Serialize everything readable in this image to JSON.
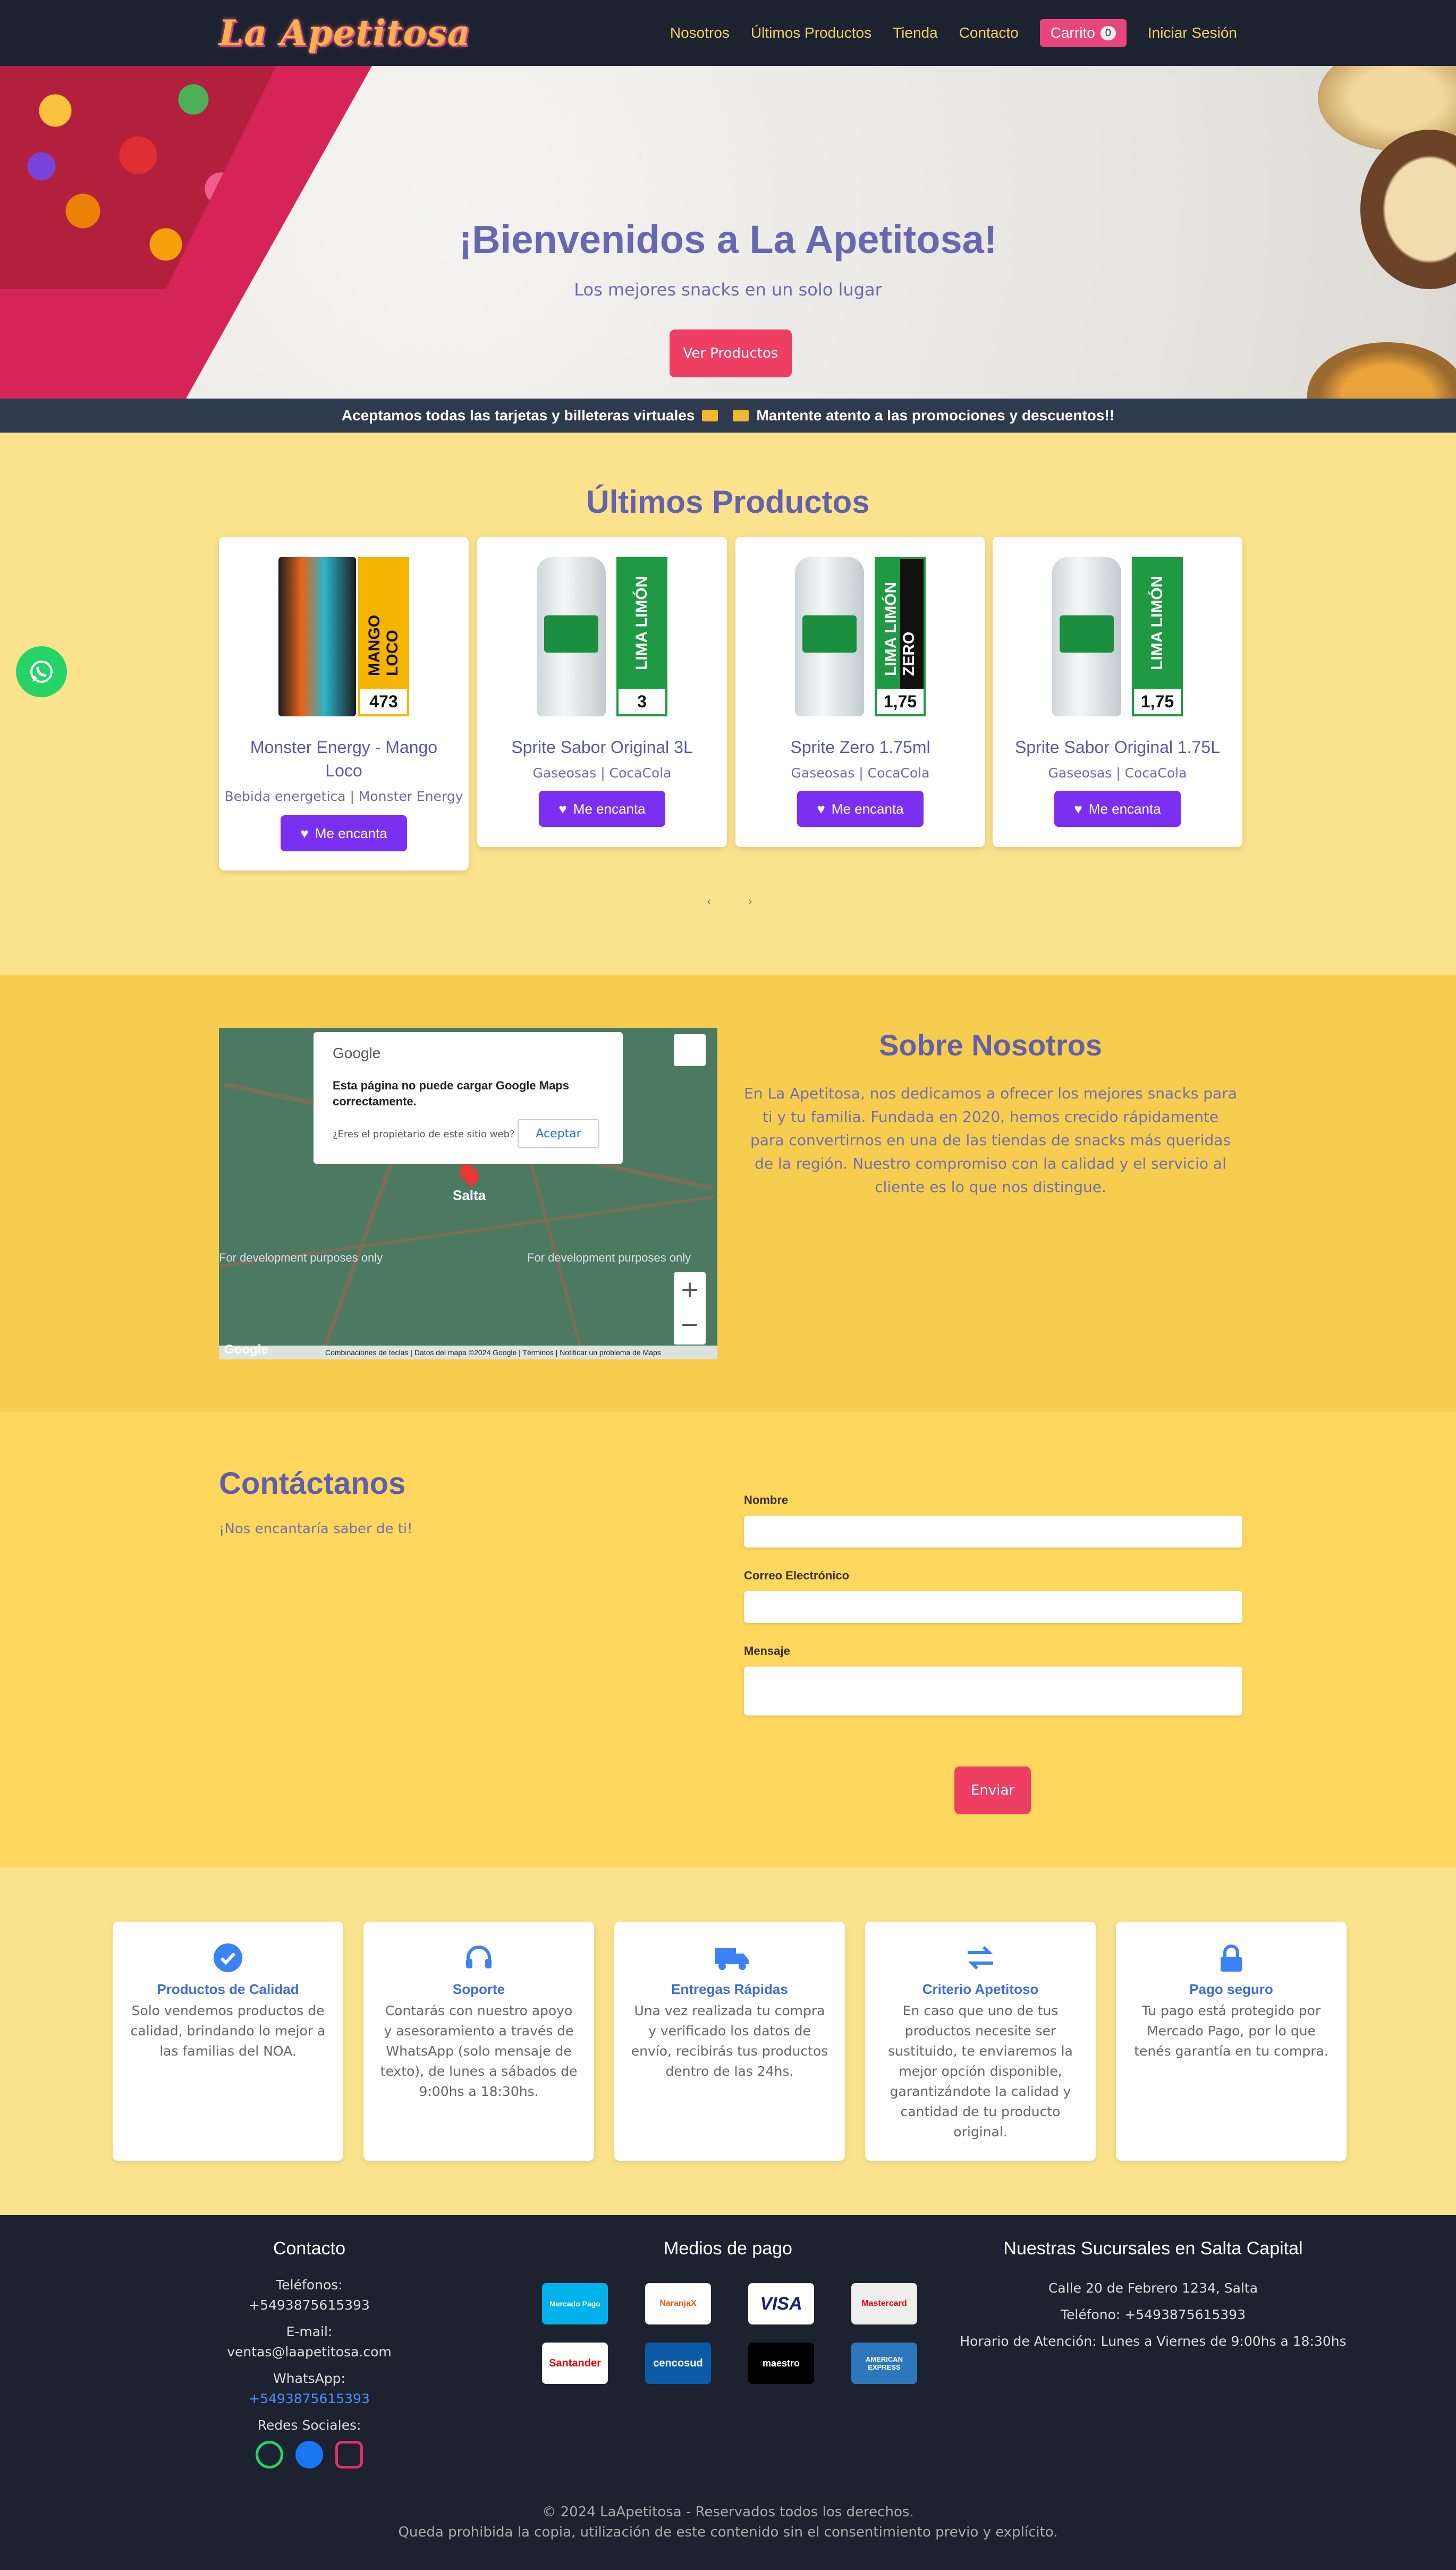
{
  "nav": {
    "brand": "La Apetitosa",
    "links": [
      "Nosotros",
      "Últimos Productos",
      "Tienda",
      "Contacto"
    ],
    "cart_label": "Carrito",
    "cart_count": "0",
    "login": "Iniciar Sesión"
  },
  "hero": {
    "title": "¡Bienvenidos a La Apetitosa!",
    "subtitle": "Los mejores snacks en un solo lugar",
    "cta": "Ver Productos"
  },
  "banner": {
    "left": "Aceptamos todas las tarjetas y billeteras virtuales",
    "right": "Mantente atento a las promociones y descuentos!!"
  },
  "latest": {
    "title": "Últimos Productos",
    "like_label": "Me encanta",
    "products": [
      {
        "name": "Monster Energy - Mango Loco",
        "category": "Bebida energetica | Monster Energy",
        "tag": "MANGO LOCO",
        "num": "473"
      },
      {
        "name": "Sprite Sabor Original 3L",
        "category": "Gaseosas | CocaCola",
        "tag": "LIMA LIMÓN",
        "num": "3"
      },
      {
        "name": "Sprite Zero 1.75ml",
        "category": "Gaseosas | CocaCola",
        "tag": "LIMA LIMÓN ZERO",
        "num": "1,75"
      },
      {
        "name": "Sprite Sabor Original 1.75L",
        "category": "Gaseosas | CocaCola",
        "tag": "LIMA LIMÓN",
        "num": "1,75"
      }
    ],
    "prev": "‹",
    "next": "›"
  },
  "about": {
    "title": "Sobre Nosotros",
    "text": "En La Apetitosa, nos dedicamos a ofrecer los mejores snacks para ti y tu familia. Fundada en 2020, hemos crecido rápidamente para convertirnos en una de las tiendas de snacks más queridas de la región. Nuestro compromiso con la calidad y el servicio al cliente es lo que nos distingue.",
    "map": {
      "brand": "Google",
      "message": "Esta página no puede cargar Google Maps correctamente.",
      "question": "¿Eres el propietario de este sitio web?",
      "accept": "Aceptar",
      "city": "Salta",
      "dev1": "For development purposes only",
      "dev2": "For development purposes only",
      "footer": "Combinaciones de teclas | Datos del mapa ©2024 Google | Términos | Notificar un problema de Maps",
      "logo": "Google"
    }
  },
  "contact": {
    "title": "Contáctanos",
    "subtitle": "¡Nos encantaría saber de ti!",
    "name_label": "Nombre",
    "email_label": "Correo Electrónico",
    "message_label": "Mensaje",
    "send": "Enviar"
  },
  "features": [
    {
      "icon": "check-badge-icon",
      "title": "Productos de Calidad",
      "text": "Solo vendemos productos de calidad, brindando lo mejor a las familias del NOA."
    },
    {
      "icon": "headset-icon",
      "title": "Soporte",
      "text": "Contarás con nuestro apoyo y asesoramiento a través de WhatsApp (solo mensaje de texto), de lunes a sábados de 9:00hs a 18:30hs."
    },
    {
      "icon": "truck-icon",
      "title": "Entregas Rápidas",
      "text": "Una vez realizada tu compra y verificado los datos de envío, recibirás tus productos dentro de las 24hs."
    },
    {
      "icon": "swap-arrows-icon",
      "title": "Criterio Apetitoso",
      "text": "En caso que uno de tus productos necesite ser sustituido, te enviaremos la mejor opción disponible, garantizándote la calidad y cantidad de tu producto original."
    },
    {
      "icon": "lock-icon",
      "title": "Pago seguro",
      "text": "Tu pago está protegido por Mercado Pago, por lo que tenés garantía en tu compra."
    }
  ],
  "footer": {
    "contact_title": "Contacto",
    "phones_label": "Teléfonos:",
    "phone": "+5493875615393",
    "email_label": "E-mail:",
    "email": "ventas@laapetitosa.com",
    "whatsapp_label": "WhatsApp:",
    "whatsapp": "+5493875615393",
    "social_label": "Redes Sociales:",
    "payments_title": "Medios de pago",
    "payments": [
      "Mercado Pago",
      "NaranjaX",
      "VISA",
      "Mastercard",
      "Santander",
      "cencosud",
      "maestro",
      "AMERICAN EXPRESS"
    ],
    "branches_title": "Nuestras Sucursales en Salta Capital",
    "address": "Calle 20 de Febrero 1234, Salta",
    "branch_phone": "Teléfono: +5493875615393",
    "hours": "Horario de Atención: Lunes a Viernes de 9:00hs a 18:30hs",
    "copyright": "© 2024 LaApetitosa - Reservados todos los derechos.",
    "notice": "Queda prohibida la copia, utilización de este contenido sin el consentimiento previo y explícito."
  }
}
